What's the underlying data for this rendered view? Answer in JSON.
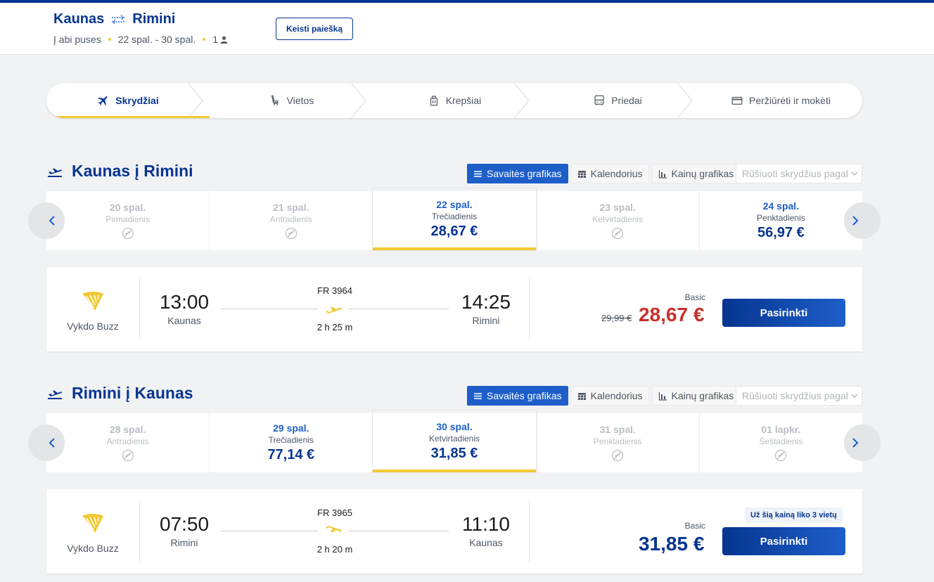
{
  "header": {
    "origin": "Kaunas",
    "destination": "Rimini",
    "trip_type": "Į abi puses",
    "dates": "22 spal. - 30 spal.",
    "passengers": "1",
    "change_search_label": "Keisti paiešką"
  },
  "steps": [
    {
      "label": "Skrydžiai",
      "icon": "plane-icon",
      "active": true
    },
    {
      "label": "Vietos",
      "icon": "seat-icon",
      "active": false
    },
    {
      "label": "Krepšiai",
      "icon": "bag-icon",
      "active": false
    },
    {
      "label": "Priedai",
      "icon": "bus-icon",
      "active": false
    },
    {
      "label": "Peržiūrėti ir mokėti",
      "icon": "card-icon",
      "active": false
    }
  ],
  "view_tabs": {
    "week": "Savaitės grafikas",
    "calendar": "Kalendorius",
    "price_chart": "Kainų grafikas",
    "sort_placeholder": "Rūšiuoti skrydžius pagal"
  },
  "outbound": {
    "title": "Kaunas į Rimini",
    "dates": [
      {
        "date": "20 spal.",
        "weekday": "Pirmadienis",
        "price": null,
        "disabled": true
      },
      {
        "date": "21 spal.",
        "weekday": "Antradienis",
        "price": null,
        "disabled": true
      },
      {
        "date": "22 spal.",
        "weekday": "Trečiadienis",
        "price": "28,67 €",
        "disabled": false,
        "selected": true
      },
      {
        "date": "23 spal.",
        "weekday": "Ketvirtadienis",
        "price": null,
        "disabled": true
      },
      {
        "date": "24 spal.",
        "weekday": "Penktadienis",
        "price": "56,97 €",
        "disabled": false
      }
    ],
    "flight": {
      "operator": "Vykdo Buzz",
      "depart_time": "13:00",
      "depart_city": "Kaunas",
      "flight_number": "FR 3964",
      "duration": "2 h 25 m",
      "arrive_time": "14:25",
      "arrive_city": "Rimini",
      "fare": "Basic",
      "old_price": "29,99 €",
      "price": "28,67 €",
      "price_color": "#c9302c",
      "select_label": "Pasirinkti"
    }
  },
  "inbound": {
    "title": "Rimini į Kaunas",
    "dates": [
      {
        "date": "28 spal.",
        "weekday": "Antradienis",
        "price": null,
        "disabled": true
      },
      {
        "date": "29 spal.",
        "weekday": "Trečiadienis",
        "price": "77,14 €",
        "disabled": false
      },
      {
        "date": "30 spal.",
        "weekday": "Ketvirtadienis",
        "price": "31,85 €",
        "disabled": false,
        "selected": true
      },
      {
        "date": "31 spal.",
        "weekday": "Penktadienis",
        "price": null,
        "disabled": true
      },
      {
        "date": "01 lapkr.",
        "weekday": "Šeštadienis",
        "price": null,
        "disabled": true
      }
    ],
    "flight": {
      "operator": "Vykdo Buzz",
      "depart_time": "07:50",
      "depart_city": "Rimini",
      "flight_number": "FR 3965",
      "duration": "2 h 20 m",
      "arrive_time": "11:10",
      "arrive_city": "Kaunas",
      "fare": "Basic",
      "seats_left": "Už šią kainą liko 3 vietų",
      "price": "31,85 €",
      "price_color": "#073590",
      "select_label": "Pasirinkti"
    }
  },
  "colors": {
    "brand": "#073590",
    "accent_yellow": "#f1c933",
    "link_blue": "#1d5ec9",
    "discount_red": "#c9302c"
  }
}
